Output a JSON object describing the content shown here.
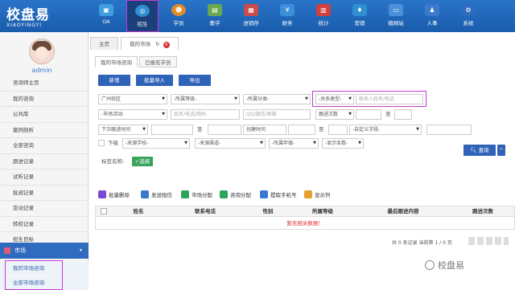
{
  "app": {
    "logo_cn": "校盘易",
    "logo_en": "XIAOYINGYI"
  },
  "nav": [
    {
      "label": "OA",
      "icon": "oa-icon",
      "color": "#3f9de0"
    },
    {
      "label": "招生",
      "icon": "admission-icon",
      "color": "#2f8fd0"
    },
    {
      "label": "学员",
      "icon": "student-icon",
      "color": "#e28b2b"
    },
    {
      "label": "教学",
      "icon": "teaching-icon",
      "color": "#6aa84f"
    },
    {
      "label": "进销存",
      "icon": "inventory-icon",
      "color": "#cc4b4b"
    },
    {
      "label": "财务",
      "icon": "finance-icon",
      "color": "#3a8fd8"
    },
    {
      "label": "统计",
      "icon": "stats-icon",
      "color": "#d04040"
    },
    {
      "label": "营销",
      "icon": "marketing-icon",
      "color": "#2f8fd0"
    },
    {
      "label": "微网站",
      "icon": "microsite-icon",
      "color": "#4a8fd8"
    },
    {
      "label": "人事",
      "icon": "hr-icon",
      "color": "#3a7ac8"
    },
    {
      "label": "系统",
      "icon": "gear-icon",
      "color": "#2f6bbf"
    }
  ],
  "user": {
    "name": "admin"
  },
  "sidebar": {
    "items": [
      "咨询师主页",
      "我的咨询",
      "公共库",
      "案例剖析",
      "全部咨询",
      "跟进记录",
      "试听记录",
      "批阅记录",
      "变动记录",
      "转校记录",
      "招生目标"
    ],
    "section": "市场",
    "sub_items": [
      "我的市场咨询",
      "全部市场咨询"
    ]
  },
  "tabs": {
    "home": "主页",
    "current": "我的市场",
    "close": "×"
  },
  "subtabs": [
    "我的市场咨询",
    "已报名学员"
  ],
  "buttons": {
    "add": "新增",
    "import": "批量导入",
    "export": "导出",
    "query": "查询",
    "tag_select": "选择"
  },
  "filters": {
    "campus": "广州校区",
    "grade": "-所属等级-",
    "category": "-所属分类-",
    "relation_type": "-关系类型-",
    "contact_placeholder": "联系人姓名/电话",
    "activity": "-市场活动-",
    "name_placeholder": "姓名/电话/简码",
    "qq_placeholder": "QQ/微信/邮箱",
    "followup_count": "跟进次数",
    "to1": "至",
    "next_followup": "下次跟进时间",
    "to2": "至",
    "created_time": "创建时间",
    "to3": "至",
    "custom_field": "-自定义字段-",
    "level_label": "下级",
    "source_school": "-来源学校-",
    "source_channel": "-来源渠道-",
    "grade_year": "-所属年级-",
    "display_count": "-显示条数-",
    "tag_label": "标签名称:"
  },
  "toolbar": [
    "批量删除",
    "发送短信",
    "市场分配",
    "咨询分配",
    "提取手机号",
    "显示列"
  ],
  "table": {
    "headers": [
      "姓名",
      "联系电话",
      "性别",
      "所属等级",
      "最后跟进内容",
      "跟进次数"
    ],
    "empty": "暂无相关数据！"
  },
  "pager": "共 0 条记录 当前第 1 / 0 页",
  "watermark": "校盘易",
  "colors": {
    "topbar": "#1f65b8",
    "accent": "#2f63b8",
    "highlight": "#c23bd3",
    "error": "#e02d2d"
  }
}
